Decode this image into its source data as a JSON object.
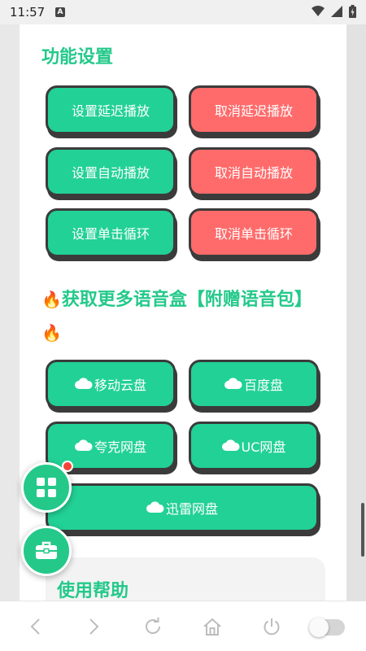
{
  "status_bar": {
    "time": "11:57",
    "notification_letter": "A"
  },
  "function_settings": {
    "title": "功能设置",
    "buttons": [
      {
        "label": "设置延迟播放",
        "color": "#22d195"
      },
      {
        "label": "取消延迟播放",
        "color": "#ff6b6b"
      },
      {
        "label": "设置自动播放",
        "color": "#22d195"
      },
      {
        "label": "取消自动播放",
        "color": "#ff6b6b"
      },
      {
        "label": "设置单击循环",
        "color": "#22d195"
      },
      {
        "label": "取消单击循环",
        "color": "#ff6b6b"
      }
    ]
  },
  "more_voice_box": {
    "title": "获取更多语音盒【附赠语音包】",
    "title_icon": "fire-icon",
    "links": [
      {
        "label": "移动云盘",
        "icon": "cloud-icon"
      },
      {
        "label": "百度盘",
        "icon": "cloud-icon"
      },
      {
        "label": "夸克网盘",
        "icon": "cloud-icon"
      },
      {
        "label": "UC网盘",
        "icon": "cloud-icon"
      },
      {
        "label": "迅雷网盘",
        "icon": "cloud-icon"
      }
    ]
  },
  "help": {
    "title": "使用帮助"
  },
  "floating_buttons": [
    {
      "icon": "grid-icon",
      "has_badge": true
    },
    {
      "icon": "toolbox-icon",
      "has_badge": false
    }
  ],
  "nav_bar": {
    "icons": [
      "back-icon",
      "forward-icon",
      "refresh-icon",
      "home-icon",
      "power-icon",
      "toggle-switch"
    ],
    "toggle_on": false
  },
  "colors": {
    "accent": "#24c98a",
    "button_green": "#22d195",
    "button_red": "#ff6b6b",
    "badge": "#f44336"
  }
}
